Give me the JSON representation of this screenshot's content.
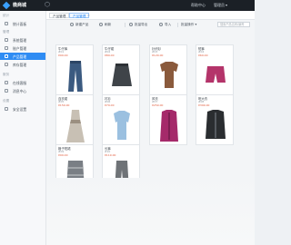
{
  "app": {
    "brand": "微商城",
    "help": "帮助中心",
    "user": "管理员",
    "caret": "▾"
  },
  "sidebar": {
    "groups": [
      {
        "label": "统计",
        "items": [
          {
            "label": "统计面板"
          }
        ]
      },
      {
        "label": "管理",
        "items": [
          {
            "label": "系统管理"
          },
          {
            "label": "账户管理"
          },
          {
            "label": "产品管理"
          },
          {
            "label": "库存管理"
          }
        ]
      },
      {
        "label": "服务",
        "items": [
          {
            "label": "在线客服"
          },
          {
            "label": "消息中心"
          }
        ]
      },
      {
        "label": "设置",
        "items": [
          {
            "label": "安全设置"
          }
        ]
      }
    ]
  },
  "tabs": [
    {
      "label": "产品管理"
    },
    {
      "label": "产品管理"
    }
  ],
  "toolbar": {
    "add": "新建产品",
    "refresh": "刷新",
    "export": "批量导出",
    "import": "导入",
    "batch": "批量操作",
    "caret": "▾",
    "search_placeholder": "搜索产品名称/编号"
  },
  "products": [
    {
      "name": "牛仔裤",
      "code": "#01",
      "price": "¥99.00",
      "kind": "jeans"
    },
    {
      "name": "牛仔裙",
      "code": "#02",
      "price": "¥89.00",
      "kind": "skirt"
    },
    {
      "name": "针织衫",
      "code": "#03",
      "price": "¥129.00",
      "kind": "sweater"
    },
    {
      "name": "短裤",
      "code": "#04",
      "price": "¥69.00",
      "kind": "shorts"
    },
    {
      "name": "连衣裙",
      "code": "#05",
      "price": "¥159.00",
      "kind": "dress"
    },
    {
      "name": "衬衫",
      "code": "#06",
      "price": "¥79.00",
      "kind": "shirt"
    },
    {
      "name": "风衣",
      "code": "#07",
      "price": "¥259.00",
      "kind": "trench"
    },
    {
      "name": "呢大衣",
      "code": "#08",
      "price": "¥399.00",
      "kind": "coat"
    },
    {
      "name": "格子短裙",
      "code": "#09",
      "price": "¥99.00",
      "kind": "plaid"
    },
    {
      "name": "长裤",
      "code": "#10",
      "price": "¥119.00",
      "kind": "pants"
    }
  ],
  "colors": {
    "accent": "#2f8cf3",
    "topbar": "#1b2026",
    "price": "#e05a3a"
  }
}
